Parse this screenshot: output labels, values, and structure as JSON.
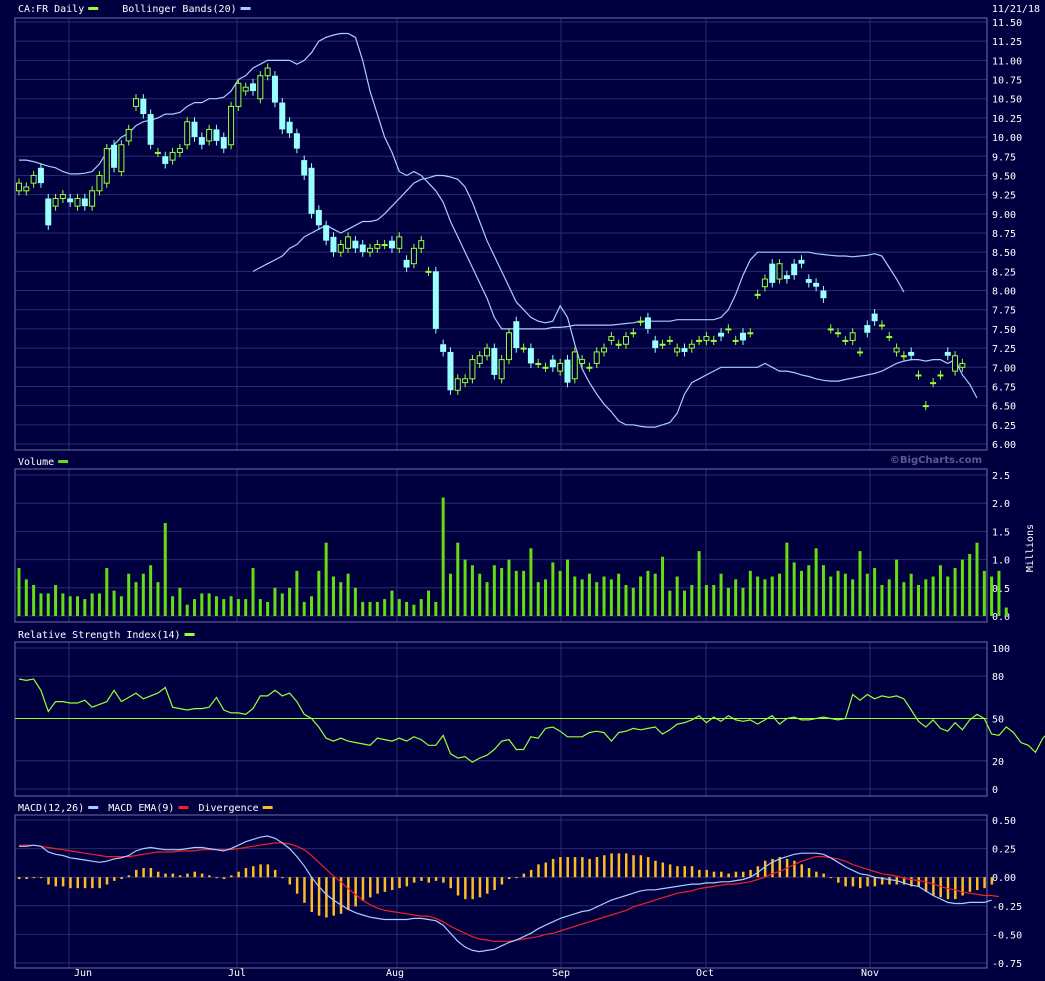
{
  "colors": {
    "background": "#000040",
    "panel_border": "#7070a0",
    "grid": "#2a2a70",
    "text": "#ffffff",
    "candle_up": "#99ff33",
    "candle_down": "#99ffff",
    "bollinger": "#aaccff",
    "volume": "#66dd11",
    "rsi": "#99ff33",
    "macd": "#aaccff",
    "macd_ema": "#ee2222",
    "divergence": "#ffbb22"
  },
  "header": {
    "date": "11/21/18",
    "watermark": "©BigCharts.com"
  },
  "x_axis": {
    "month_labels": [
      "Jun",
      "Jul",
      "Aug",
      "Sep",
      "Oct",
      "Nov"
    ]
  },
  "chart_data": [
    {
      "id": "price",
      "type": "candlestick",
      "legend": [
        {
          "label": "CA:FR Daily",
          "color": "#99ff33"
        },
        {
          "label": "Bollinger Bands(20)",
          "color": "#aaccff"
        }
      ],
      "y_ticks": [
        "11.50",
        "11.25",
        "11.00",
        "10.75",
        "10.50",
        "10.25",
        "10.00",
        "9.75",
        "9.50",
        "9.25",
        "9.00",
        "8.75",
        "8.50",
        "8.25",
        "8.00",
        "7.75",
        "7.50",
        "7.25",
        "7.00",
        "6.75",
        "6.50",
        "6.25",
        "6.00"
      ],
      "ylim": [
        6.0,
        11.5
      ],
      "close": [
        9.4,
        9.35,
        9.5,
        9.4,
        8.85,
        9.2,
        9.25,
        9.15,
        9.2,
        9.1,
        9.3,
        9.5,
        9.85,
        9.6,
        9.9,
        10.1,
        10.5,
        10.3,
        9.9,
        9.8,
        9.65,
        9.8,
        9.85,
        10.2,
        10.0,
        9.9,
        10.1,
        9.95,
        9.85,
        10.4,
        10.7,
        10.65,
        10.6,
        10.8,
        10.9,
        10.45,
        10.1,
        10.05,
        9.85,
        9.5,
        9.0,
        8.85,
        8.65,
        8.5,
        8.6,
        8.7,
        8.55,
        8.5,
        8.55,
        8.6,
        8.6,
        8.55,
        8.7,
        8.3,
        8.55,
        8.65,
        8.25,
        7.5,
        7.2,
        6.7,
        6.85,
        6.85,
        7.1,
        7.15,
        7.25,
        6.9,
        7.1,
        7.45,
        7.25,
        7.25,
        7.05,
        7.05,
        7.0,
        7.0,
        7.05,
        6.8,
        7.2,
        7.1,
        7.0,
        7.2,
        7.25,
        7.4,
        7.3,
        7.4,
        7.45,
        7.6,
        7.5,
        7.25,
        7.3,
        7.35,
        7.25,
        7.2,
        7.3,
        7.35,
        7.4,
        7.35,
        7.4,
        7.5,
        7.35,
        7.35,
        7.45,
        7.95,
        8.15,
        8.1,
        8.35,
        8.15,
        8.2,
        8.35,
        8.1,
        8.05,
        7.9,
        7.5,
        7.45,
        7.35,
        7.45,
        7.2,
        7.45,
        7.6,
        7.55,
        7.4,
        7.25,
        7.15,
        7.15,
        6.9,
        6.5,
        6.8,
        6.9,
        7.15,
        7.15,
        7.05,
        7.0,
        7.25
      ],
      "open": [
        9.3,
        9.3,
        9.4,
        9.6,
        9.2,
        9.1,
        9.2,
        9.2,
        9.1,
        9.2,
        9.1,
        9.3,
        9.4,
        9.9,
        9.55,
        9.95,
        10.4,
        10.5,
        10.3,
        9.8,
        9.75,
        9.7,
        9.8,
        9.9,
        10.2,
        10.0,
        9.95,
        10.1,
        10.0,
        9.9,
        10.4,
        10.6,
        10.7,
        10.5,
        10.8,
        10.8,
        10.45,
        10.2,
        10.05,
        9.7,
        9.6,
        9.05,
        8.85,
        8.7,
        8.5,
        8.55,
        8.65,
        8.6,
        8.5,
        8.55,
        8.6,
        8.65,
        8.55,
        8.4,
        8.35,
        8.55,
        8.25,
        8.25,
        7.3,
        7.2,
        6.7,
        6.8,
        6.85,
        7.05,
        7.15,
        7.25,
        6.85,
        7.1,
        7.6,
        7.25,
        7.25,
        7.05,
        7.0,
        7.1,
        6.95,
        7.1,
        6.85,
        7.05,
        7.0,
        7.05,
        7.2,
        7.35,
        7.3,
        7.3,
        7.45,
        7.6,
        7.65,
        7.35,
        7.3,
        7.35,
        7.2,
        7.25,
        7.25,
        7.35,
        7.35,
        7.35,
        7.45,
        7.5,
        7.35,
        7.45,
        7.45,
        7.95,
        8.05,
        8.35,
        8.15,
        8.2,
        8.35,
        8.4,
        8.15,
        8.1,
        8.0,
        7.5,
        7.45,
        7.35,
        7.35,
        7.2,
        7.55,
        7.7,
        7.55,
        7.4,
        7.2,
        7.15,
        7.2,
        6.9,
        6.5,
        6.8,
        6.9,
        7.2,
        6.95,
        7.0
      ],
      "bollinger_upper": [
        9.7,
        9.7,
        9.68,
        9.65,
        9.62,
        9.6,
        9.55,
        9.52,
        9.52,
        9.53,
        9.55,
        9.65,
        9.8,
        9.9,
        10.0,
        10.05,
        10.15,
        10.2,
        10.22,
        10.25,
        10.3,
        10.3,
        10.32,
        10.4,
        10.45,
        10.45,
        10.5,
        10.5,
        10.52,
        10.6,
        10.75,
        10.8,
        10.9,
        10.95,
        11.0,
        11.0,
        11.0,
        11.0,
        10.95,
        11.0,
        11.1,
        11.25,
        11.3,
        11.33,
        11.35,
        11.35,
        11.3,
        11.0,
        10.6,
        10.3,
        10.0,
        9.8,
        9.55,
        9.5,
        9.55,
        9.5,
        9.4,
        9.3,
        9.15,
        8.9,
        8.7,
        8.5,
        8.3,
        8.1,
        7.9,
        7.65,
        7.5,
        7.5,
        7.5,
        7.5,
        7.5,
        7.5,
        7.5,
        7.52,
        7.52,
        7.53,
        7.55,
        7.55,
        7.55,
        7.55,
        7.55,
        7.55,
        7.56,
        7.57,
        7.58,
        7.6,
        7.6,
        7.6,
        7.6,
        7.6,
        7.62,
        7.62,
        7.62,
        7.62,
        7.62,
        7.62,
        7.65,
        7.75,
        7.95,
        8.2,
        8.4,
        8.5,
        8.5,
        8.5,
        8.5,
        8.5,
        8.5,
        8.5,
        8.5,
        8.48,
        8.47,
        8.46,
        8.45,
        8.45,
        8.44,
        8.45,
        8.46,
        8.48,
        8.45,
        8.3,
        8.15,
        7.98
      ],
      "bollinger_lower": [
        8.25,
        8.3,
        8.35,
        8.4,
        8.45,
        8.55,
        8.6,
        8.7,
        8.75,
        8.8,
        8.85,
        8.8,
        8.75,
        8.8,
        8.85,
        8.9,
        8.9,
        8.92,
        9.0,
        9.1,
        9.2,
        9.3,
        9.4,
        9.45,
        9.47,
        9.5,
        9.5,
        9.48,
        9.45,
        9.35,
        9.15,
        8.9,
        8.65,
        8.45,
        8.25,
        8.05,
        7.85,
        7.75,
        7.65,
        7.6,
        7.58,
        7.6,
        7.8,
        7.65,
        7.3,
        6.98,
        6.8,
        6.65,
        6.52,
        6.42,
        6.3,
        6.25,
        6.25,
        6.23,
        6.22,
        6.22,
        6.25,
        6.28,
        6.4,
        6.65,
        6.8,
        6.85,
        6.9,
        6.95,
        7.0,
        7.0,
        7.0,
        7.0,
        7.0,
        7.0,
        7.05,
        7.0,
        6.95,
        6.95,
        6.93,
        6.9,
        6.88,
        6.85,
        6.83,
        6.82,
        6.82,
        6.84,
        6.86,
        6.88,
        6.9,
        6.92,
        6.95,
        7.0,
        7.05,
        7.08,
        7.1,
        7.1,
        7.08,
        7.1,
        7.1,
        7.05,
        7.1,
        6.9,
        6.78,
        6.6
      ],
      "x_tick_positions": "month_separators"
    },
    {
      "id": "volume",
      "type": "bar",
      "legend": [
        {
          "label": "Volume",
          "color": "#66dd11"
        }
      ],
      "y_ticks": [
        "2.5",
        "2.0",
        "1.5",
        "1.0",
        "0.5",
        "0.0"
      ],
      "ylabel": "Millions",
      "ylim": [
        0,
        2.5
      ],
      "values": [
        0.85,
        0.65,
        0.55,
        0.4,
        0.4,
        0.55,
        0.4,
        0.35,
        0.35,
        0.3,
        0.4,
        0.4,
        0.85,
        0.45,
        0.35,
        0.75,
        0.6,
        0.75,
        0.9,
        0.6,
        1.65,
        0.35,
        0.5,
        0.2,
        0.3,
        0.4,
        0.4,
        0.35,
        0.3,
        0.35,
        0.3,
        0.3,
        0.85,
        0.3,
        0.25,
        0.5,
        0.4,
        0.5,
        0.8,
        0.25,
        0.35,
        0.8,
        1.3,
        0.7,
        0.6,
        0.75,
        0.5,
        0.25,
        0.25,
        0.25,
        0.3,
        0.45,
        0.3,
        0.25,
        0.2,
        0.3,
        0.45,
        0.25,
        2.1,
        0.75,
        1.3,
        1.0,
        0.9,
        0.75,
        0.6,
        0.9,
        0.85,
        1.0,
        0.8,
        0.8,
        1.2,
        0.6,
        0.65,
        0.95,
        0.8,
        1.0,
        0.7,
        0.65,
        0.75,
        0.6,
        0.7,
        0.65,
        0.75,
        0.55,
        0.5,
        0.7,
        0.8,
        0.75,
        1.05,
        0.45,
        0.7,
        0.45,
        0.55,
        1.15,
        0.55,
        0.55,
        0.75,
        0.5,
        0.65,
        0.5,
        0.8,
        0.7,
        0.65,
        0.7,
        0.75,
        1.3,
        0.95,
        0.8,
        0.9,
        1.2,
        0.9,
        0.7,
        0.8,
        0.75,
        0.65,
        1.15,
        0.75,
        0.85,
        0.55,
        0.65,
        1.0,
        0.6,
        0.75,
        0.55,
        0.65,
        0.7,
        0.9,
        0.7,
        0.85,
        1.0,
        1.1,
        1.3,
        0.8,
        0.7,
        0.8,
        0.15
      ],
      "x_tick_positions": "month_separators"
    },
    {
      "id": "rsi",
      "type": "line",
      "legend": [
        {
          "label": "Relative Strength Index(14)",
          "color": "#99ff33"
        }
      ],
      "y_ticks": [
        "100",
        "80",
        "50",
        "20",
        "0"
      ],
      "ylim": [
        0,
        100
      ],
      "reference_line": 50,
      "values": [
        78,
        77,
        78,
        70,
        55,
        62,
        62,
        61,
        61,
        63,
        58,
        60,
        62,
        70,
        62,
        65,
        68,
        64,
        66,
        68,
        72,
        58,
        57,
        56,
        57,
        57,
        58,
        65,
        56,
        54,
        54,
        53,
        57,
        66,
        66,
        70,
        66,
        68,
        62,
        53,
        50,
        44,
        36,
        34,
        36,
        34,
        33,
        32,
        31,
        36,
        35,
        34,
        36,
        34,
        37,
        35,
        31,
        31,
        38,
        25,
        22,
        23,
        19,
        22,
        24,
        28,
        34,
        35,
        28,
        28,
        37,
        36,
        43,
        44,
        41,
        37,
        37,
        37,
        40,
        41,
        40,
        34,
        40,
        41,
        43,
        42,
        43,
        44,
        39,
        42,
        46,
        47,
        49,
        52,
        47,
        51,
        48,
        52,
        49,
        48,
        49,
        46,
        49,
        52,
        46,
        50,
        51,
        49,
        49,
        50,
        51,
        50,
        49,
        50,
        67,
        63,
        67,
        64,
        66,
        65,
        66,
        64,
        56,
        48,
        44,
        49,
        43,
        41,
        47,
        42,
        49,
        53,
        50,
        39,
        38,
        44,
        40,
        33,
        31,
        26,
        36,
        41,
        39,
        44,
        43,
        45,
        50
      ]
    },
    {
      "id": "macd",
      "type": "line+bar",
      "legend": [
        {
          "label": "MACD(12,26)",
          "color": "#aaccff"
        },
        {
          "label": "MACD EMA(9)",
          "color": "#ee2222"
        },
        {
          "label": "Divergence",
          "color": "#ffbb22"
        }
      ],
      "y_ticks": [
        "0.50",
        "0.25",
        "0.00",
        "-0.25",
        "-0.50",
        "-0.75"
      ],
      "ylim": [
        -0.75,
        0.5
      ],
      "macd": [
        0.27,
        0.27,
        0.28,
        0.27,
        0.22,
        0.2,
        0.19,
        0.17,
        0.16,
        0.15,
        0.14,
        0.13,
        0.14,
        0.16,
        0.17,
        0.19,
        0.23,
        0.25,
        0.26,
        0.25,
        0.24,
        0.24,
        0.24,
        0.25,
        0.26,
        0.26,
        0.25,
        0.24,
        0.23,
        0.25,
        0.28,
        0.31,
        0.33,
        0.35,
        0.36,
        0.34,
        0.3,
        0.25,
        0.18,
        0.1,
        0.0,
        -0.08,
        -0.15,
        -0.2,
        -0.24,
        -0.28,
        -0.31,
        -0.33,
        -0.35,
        -0.36,
        -0.37,
        -0.37,
        -0.37,
        -0.37,
        -0.36,
        -0.36,
        -0.37,
        -0.38,
        -0.42,
        -0.49,
        -0.56,
        -0.61,
        -0.64,
        -0.65,
        -0.64,
        -0.63,
        -0.6,
        -0.57,
        -0.55,
        -0.52,
        -0.49,
        -0.45,
        -0.42,
        -0.39,
        -0.36,
        -0.34,
        -0.32,
        -0.3,
        -0.29,
        -0.26,
        -0.23,
        -0.2,
        -0.18,
        -0.16,
        -0.14,
        -0.12,
        -0.11,
        -0.11,
        -0.1,
        -0.09,
        -0.08,
        -0.07,
        -0.06,
        -0.06,
        -0.05,
        -0.05,
        -0.04,
        -0.04,
        -0.03,
        -0.02,
        0.0,
        0.04,
        0.09,
        0.13,
        0.16,
        0.18,
        0.2,
        0.21,
        0.21,
        0.21,
        0.2,
        0.17,
        0.13,
        0.09,
        0.06,
        0.03,
        0.02,
        0.0,
        -0.01,
        -0.02,
        -0.03,
        -0.05,
        -0.07,
        -0.08,
        -0.12,
        -0.16,
        -0.19,
        -0.22,
        -0.23,
        -0.23,
        -0.22,
        -0.22,
        -0.22,
        -0.2
      ],
      "ema": [
        0.28,
        0.28,
        0.28,
        0.27,
        0.26,
        0.25,
        0.24,
        0.23,
        0.22,
        0.21,
        0.2,
        0.19,
        0.18,
        0.18,
        0.18,
        0.18,
        0.19,
        0.2,
        0.21,
        0.22,
        0.22,
        0.22,
        0.23,
        0.23,
        0.23,
        0.24,
        0.24,
        0.24,
        0.24,
        0.24,
        0.25,
        0.26,
        0.27,
        0.28,
        0.29,
        0.3,
        0.3,
        0.29,
        0.27,
        0.24,
        0.19,
        0.13,
        0.07,
        0.01,
        -0.04,
        -0.1,
        -0.15,
        -0.2,
        -0.24,
        -0.27,
        -0.29,
        -0.3,
        -0.31,
        -0.32,
        -0.33,
        -0.34,
        -0.34,
        -0.36,
        -0.39,
        -0.43,
        -0.46,
        -0.49,
        -0.52,
        -0.54,
        -0.55,
        -0.56,
        -0.56,
        -0.56,
        -0.55,
        -0.54,
        -0.53,
        -0.52,
        -0.5,
        -0.49,
        -0.47,
        -0.45,
        -0.43,
        -0.41,
        -0.39,
        -0.37,
        -0.35,
        -0.33,
        -0.31,
        -0.29,
        -0.26,
        -0.24,
        -0.22,
        -0.2,
        -0.18,
        -0.16,
        -0.14,
        -0.13,
        -0.12,
        -0.1,
        -0.09,
        -0.08,
        -0.07,
        -0.06,
        -0.06,
        -0.05,
        -0.04,
        -0.02,
        0.0,
        0.03,
        0.05,
        0.08,
        0.11,
        0.14,
        0.16,
        0.18,
        0.18,
        0.17,
        0.16,
        0.14,
        0.11,
        0.09,
        0.07,
        0.05,
        0.03,
        0.02,
        0.01,
        -0.01,
        -0.02,
        -0.03,
        -0.04,
        -0.06,
        -0.08,
        -0.1,
        -0.11,
        -0.13,
        -0.14,
        -0.15,
        -0.16,
        -0.16,
        -0.17
      ]
    }
  ]
}
